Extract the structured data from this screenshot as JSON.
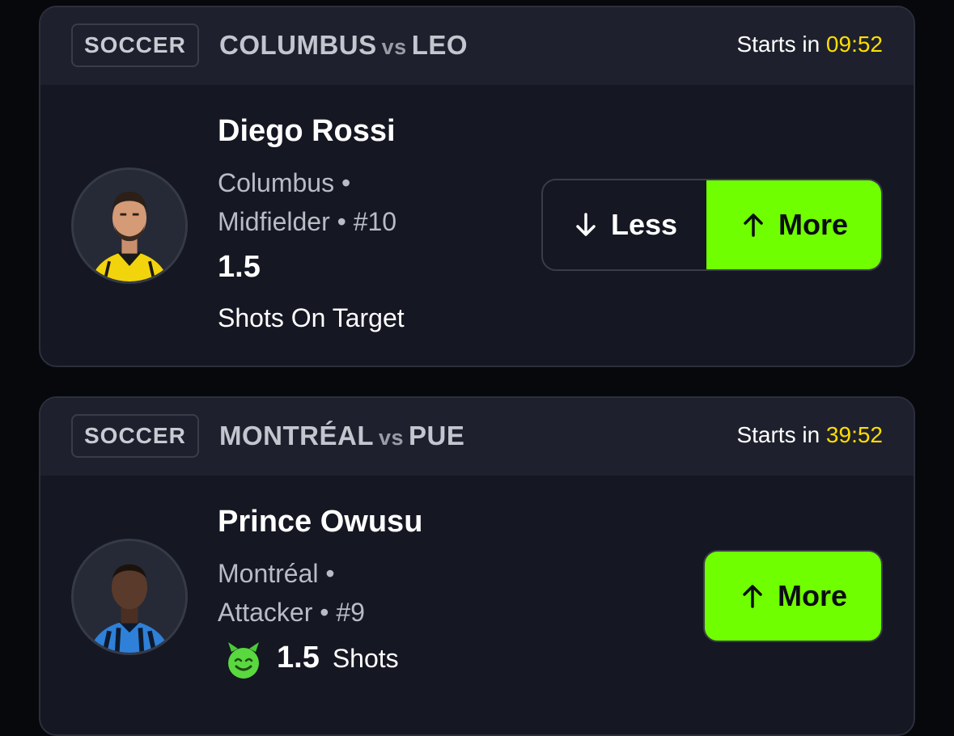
{
  "cards": [
    {
      "sport": "SOCCER",
      "home_team": "COLUMBUS",
      "vs": "vs",
      "away_team": "LEO",
      "starts_label": "Starts in",
      "starts_time": "09:52",
      "player_name": "Diego Rossi",
      "team": "Columbus •",
      "position_line": "Midfielder • #10",
      "stat_value": "1.5",
      "stat_label": "Shots On Target",
      "less_label": "Less",
      "more_label": "More",
      "jersey_color": "#f2d40c"
    },
    {
      "sport": "SOCCER",
      "home_team": "MONTRÉAL",
      "vs": "vs",
      "away_team": "PUE",
      "starts_label": "Starts in",
      "starts_time": "39:52",
      "player_name": "Prince Owusu",
      "team": "Montréal •",
      "position_line": "Attacker • #9",
      "stat_value": "1.5",
      "stat_label": "Shots",
      "more_label": "More",
      "badge_icon": "devil-emoji-icon",
      "jersey_color": "#2f80d8"
    }
  ],
  "colors": {
    "accent_green": "#6fff00",
    "timer_yellow": "#ffde00"
  }
}
